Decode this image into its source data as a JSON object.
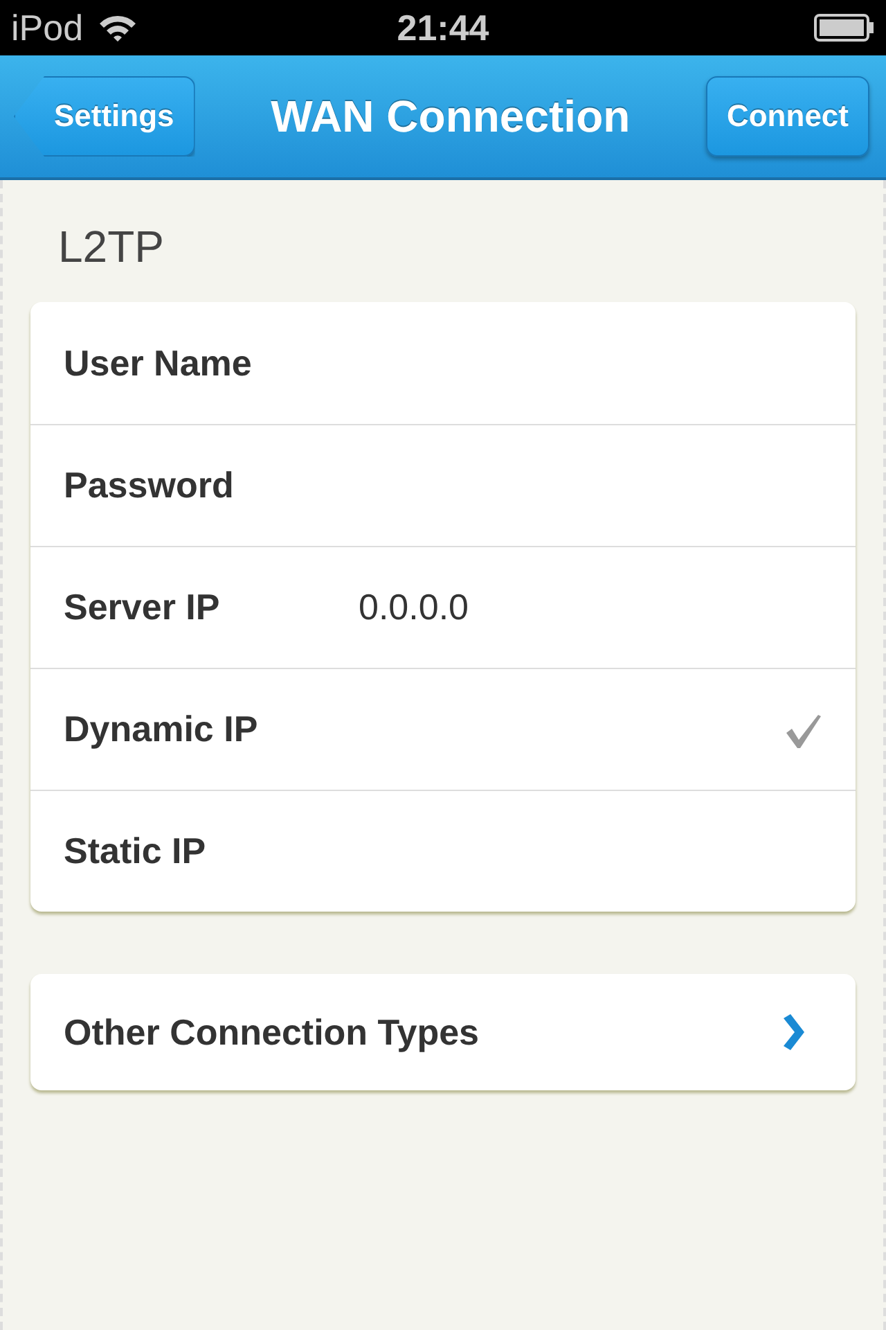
{
  "status_bar": {
    "carrier": "iPod",
    "time": "21:44"
  },
  "nav": {
    "back": "Settings",
    "title": "WAN Connection",
    "action": "Connect"
  },
  "section": {
    "title": "L2TP"
  },
  "rows": [
    {
      "kind": "field",
      "label": "User Name",
      "value": ""
    },
    {
      "kind": "field",
      "label": "Password",
      "value": ""
    },
    {
      "kind": "field",
      "label": "Server IP",
      "value": "0.0.0.0"
    },
    {
      "kind": "option",
      "label": "Dynamic IP",
      "selected": true
    },
    {
      "kind": "option",
      "label": "Static IP",
      "selected": false
    }
  ],
  "links": [
    {
      "label": "Other Connection Types"
    }
  ]
}
